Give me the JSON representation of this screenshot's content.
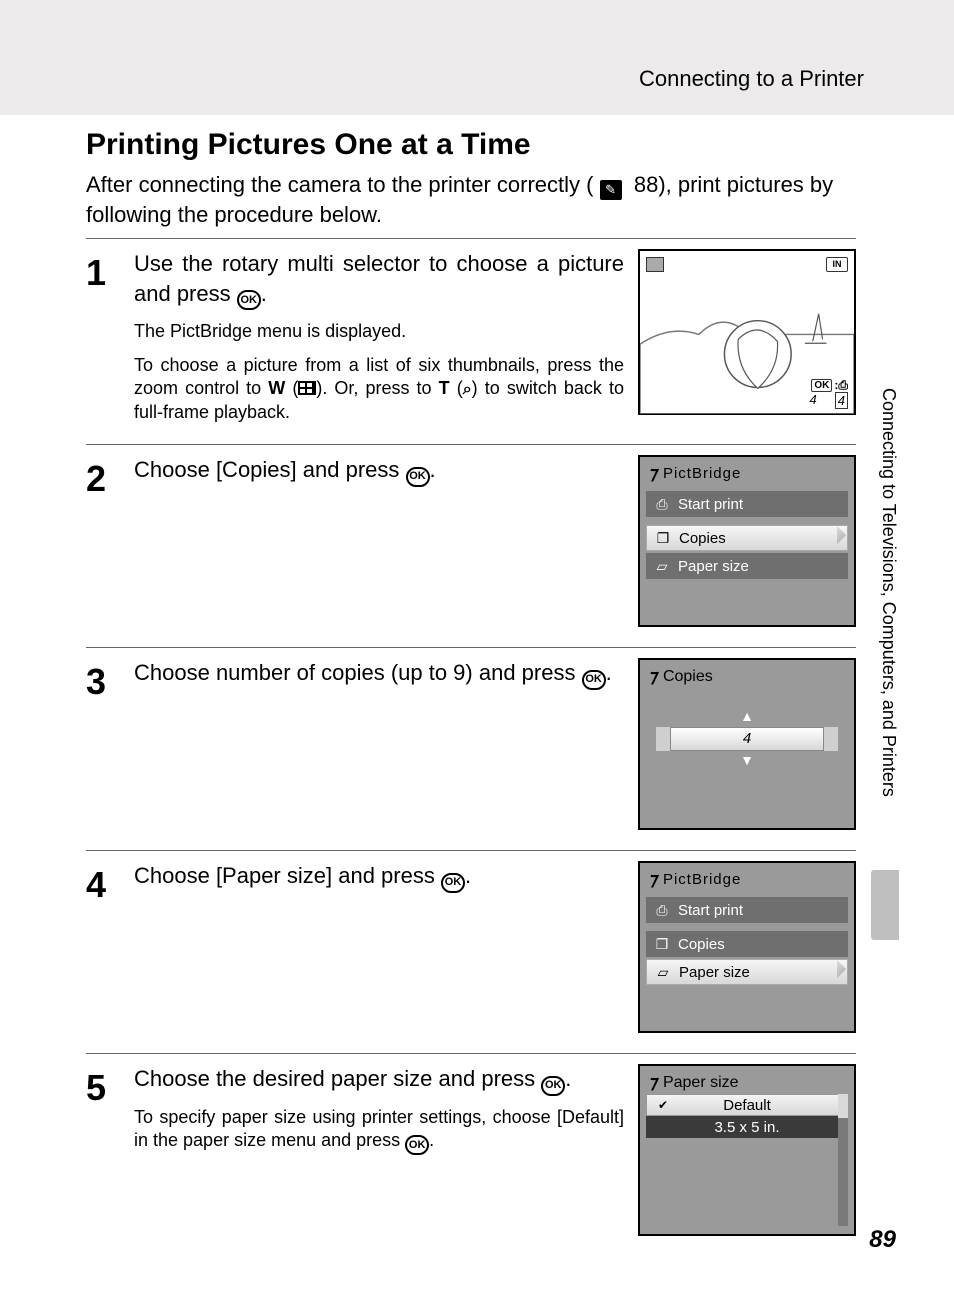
{
  "header": {
    "breadcrumb": "Connecting to a Printer"
  },
  "title": "Printing Pictures One at a Time",
  "intro_before": "After connecting the camera to the printer correctly (",
  "intro_ref": "88",
  "intro_after": "), print pictures by following the procedure below.",
  "side_label": "Connecting to Televisions, Computers, and Printers",
  "page_number": "89",
  "steps": {
    "s1": {
      "num": "1",
      "instr_a": "Use the rotary multi selector to choose a picture and press ",
      "instr_b": ".",
      "note1": "The PictBridge menu is displayed.",
      "note2_a": "To choose a picture from a list of six thumbnails, press the zoom control to ",
      "note2_w": "W",
      "note2_b": " (",
      "note2_c": "). Or, press to ",
      "note2_t": "T",
      "note2_d": " (",
      "note2_mag": "i",
      "note2_e": ") to switch back to full-frame playback.",
      "screen": {
        "ok": "OK",
        "count_cur": "4",
        "count_total": "4",
        "in": "IN"
      }
    },
    "s2": {
      "num": "2",
      "instr_a": "Choose [Copies] and press ",
      "instr_b": ".",
      "screen": {
        "title": "PictBridge",
        "items": [
          {
            "icon": "print",
            "label": "Start print",
            "selected": false
          },
          {
            "icon": "copies",
            "label": "Copies",
            "selected": true
          },
          {
            "icon": "paper",
            "label": "Paper size",
            "selected": false
          }
        ]
      }
    },
    "s3": {
      "num": "3",
      "instr_a": "Choose number of copies (up to 9) and press ",
      "instr_b": ".",
      "screen": {
        "title": "Copies",
        "value": "4"
      }
    },
    "s4": {
      "num": "4",
      "instr_a": "Choose [Paper size] and press ",
      "instr_b": ".",
      "screen": {
        "title": "PictBridge",
        "items": [
          {
            "icon": "print",
            "label": "Start print",
            "selected": false
          },
          {
            "icon": "copies",
            "label": "Copies",
            "selected": false
          },
          {
            "icon": "paper",
            "label": "Paper size",
            "selected": true
          }
        ]
      }
    },
    "s5": {
      "num": "5",
      "instr_a": "Choose the desired paper size and press ",
      "instr_b": ".",
      "note_a": "To specify paper size using printer settings, choose [Default] in the paper size menu and press ",
      "note_b": ".",
      "screen": {
        "title": "Paper size",
        "options": [
          {
            "label": "Default",
            "selected": true,
            "checked": true
          },
          {
            "label": "3.5 x 5 in.",
            "selected": false,
            "checked": false
          }
        ]
      }
    }
  },
  "ok_label": "OK"
}
